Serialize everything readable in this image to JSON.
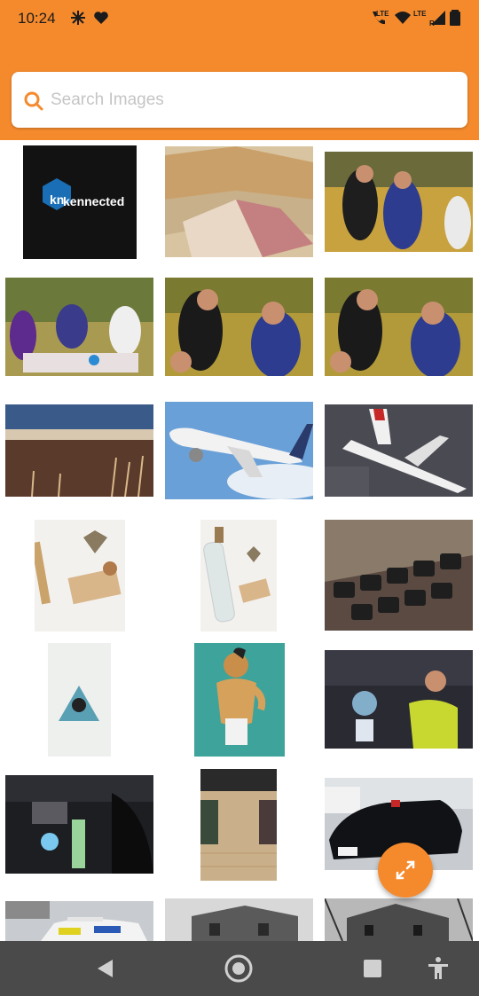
{
  "status_bar": {
    "time": "10:24",
    "left_icons": [
      "fan-icon",
      "heart-icon"
    ],
    "right_icons": [
      "call-icon",
      "wifi-icon",
      "signal-icon",
      "battery-icon"
    ],
    "network_labels": [
      "LTE",
      "LTE",
      "R",
      "R"
    ]
  },
  "search": {
    "placeholder": "Search Images",
    "value": ""
  },
  "grid": {
    "tiles": [
      {
        "name": "kennected-logo",
        "text": "kennected"
      },
      {
        "name": "food-sandwich"
      },
      {
        "name": "couple-feeding-outdoors"
      },
      {
        "name": "friends-picnic"
      },
      {
        "name": "couple-feeding-with-kid"
      },
      {
        "name": "couple-feeding-with-kid-2"
      },
      {
        "name": "sunset-grass-field"
      },
      {
        "name": "airplane-in-sky"
      },
      {
        "name": "airplane-on-ground"
      },
      {
        "name": "flat-lay-note-bottle"
      },
      {
        "name": "bottle-with-note"
      },
      {
        "name": "laptop-keyboard"
      },
      {
        "name": "illustration-triangle-portrait"
      },
      {
        "name": "illustration-muscular-man"
      },
      {
        "name": "man-with-hologram"
      },
      {
        "name": "dark-room-hologram"
      },
      {
        "name": "supermarket-aisle"
      },
      {
        "name": "black-jaguar-car"
      },
      {
        "name": "police-car"
      },
      {
        "name": "old-house-bw"
      },
      {
        "name": "old-house-dark"
      }
    ]
  },
  "fab": {
    "icon": "expand-icon"
  },
  "nav_bar": {
    "buttons": [
      "back-icon",
      "home-icon",
      "recents-icon",
      "accessibility-icon"
    ]
  },
  "colors": {
    "accent": "#F58A2D",
    "nav_background": "#4a4a4a",
    "placeholder_text": "#c5c5c5"
  }
}
